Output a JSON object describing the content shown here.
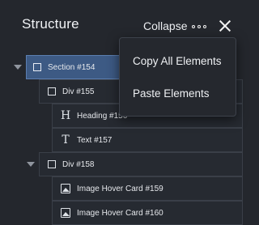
{
  "header": {
    "title": "Structure",
    "collapse_label": "Collapse"
  },
  "tree": [
    {
      "label": "Section #154",
      "icon": "square-icon",
      "caret": true,
      "selected": true
    },
    {
      "label": "Div #155",
      "icon": "square-icon",
      "caret": false,
      "selected": false
    },
    {
      "label": "Heading #156",
      "icon": "heading-icon",
      "caret": false,
      "selected": false
    },
    {
      "label": "Text #157",
      "icon": "text-icon",
      "caret": false,
      "selected": false
    },
    {
      "label": "Div #158",
      "icon": "square-icon",
      "caret": true,
      "selected": false
    },
    {
      "label": "Image Hover Card #159",
      "icon": "image-icon",
      "caret": false,
      "selected": false
    },
    {
      "label": "Image Hover Card #160",
      "icon": "image-icon",
      "caret": false,
      "selected": false
    }
  ],
  "menu": {
    "items": [
      "Copy All Elements",
      "Paste Elements"
    ]
  },
  "colors": {
    "background": "#24272d",
    "selected_row": "#3d5a84"
  }
}
